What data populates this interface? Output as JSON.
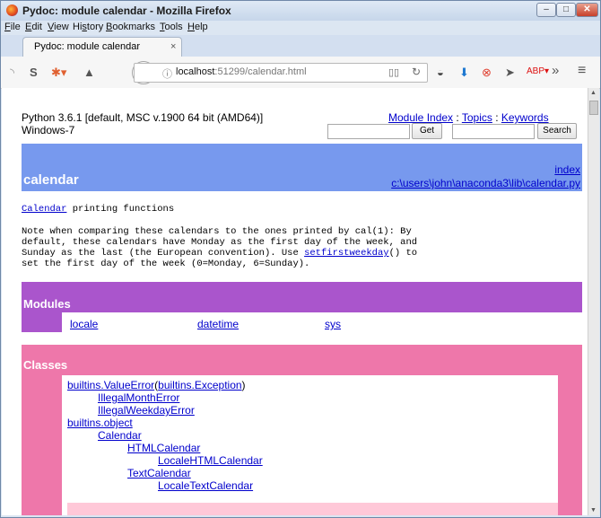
{
  "window": {
    "title": "Pydoc: module calendar - Mozilla Firefox"
  },
  "menu": [
    "File",
    "Edit",
    "View",
    "History",
    "Bookmarks",
    "Tools",
    "Help"
  ],
  "menu_mnemonic": [
    "F",
    "E",
    "V",
    "s",
    "B",
    "T",
    "H"
  ],
  "tab": {
    "label": "Pydoc: module calendar",
    "close": "×"
  },
  "navbar": {
    "url_host": "localhost",
    "url_rest": ":51299/calendar.html",
    "overflow": "»",
    "menu": "≡"
  },
  "header": {
    "python_version": "Python 3.6.1 [default, MSC v.1900 64 bit (AMD64)]",
    "os": "Windows-7",
    "module_index": "Module Index",
    "sep1": " : ",
    "topics": "Topics",
    "sep2": " : ",
    "keywords": "Keywords",
    "get_button": "Get",
    "search_button": "Search"
  },
  "module": {
    "name": "calendar",
    "index_link": "index",
    "file_link": "c:\\users\\john\\anaconda3\\lib\\calendar.py",
    "doc_link": "Calendar",
    "doc_rest": " printing functions",
    "para_line1": "Note when comparing these calendars to the ones printed by cal(1): By",
    "para_line2": "default, these calendars have Monday as the first day of the week, and",
    "para_line3a": "Sunday as the last (the European convention). Use ",
    "para_line3_link": "setfirstweekday",
    "para_line3b": "() to",
    "para_line4": "set the first day of the week (0=Monday, 6=Sunday)."
  },
  "modules_section": {
    "title": "Modules",
    "items": [
      "locale",
      "datetime",
      "sys"
    ]
  },
  "classes_section": {
    "title": "Classes",
    "value_error": "builtins.ValueError",
    "value_error_open": "(",
    "exception": "builtins.Exception",
    "value_error_close": ")",
    "illegal_month": "IllegalMonthError",
    "illegal_weekday": "IllegalWeekdayError",
    "builtins_object": "builtins.object",
    "calendar_cls": "Calendar",
    "html_calendar": "HTMLCalendar",
    "locale_html_calendar": "LocaleHTMLCalendar",
    "text_calendar": "TextCalendar",
    "locale_text_calendar": "LocaleTextCalendar"
  },
  "colors": {
    "module_band": "#7799ee",
    "modules_band": "#aa55cc",
    "classes_band": "#ee77aa",
    "classes_inner": "#ffc8d8"
  }
}
